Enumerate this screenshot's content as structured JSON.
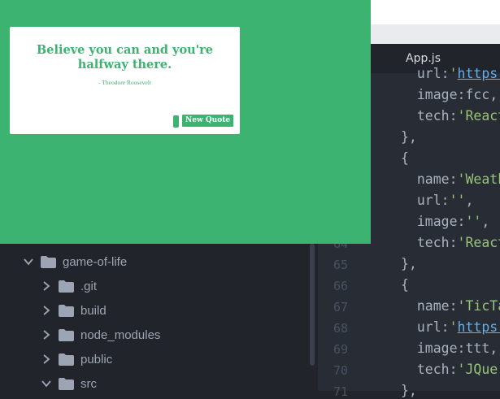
{
  "editor": {
    "tab_title": "App.js",
    "lines": [
      {
        "no": "",
        "tokens": [
          {
            "t": "  url:",
            "c": "k"
          },
          {
            "t": "'",
            "c": "s"
          },
          {
            "t": "https:",
            "c": "u"
          }
        ]
      },
      {
        "no": "",
        "tokens": [
          {
            "t": "  image:fcc,",
            "c": "k"
          }
        ]
      },
      {
        "no": "",
        "tokens": [
          {
            "t": "  tech:",
            "c": "k"
          },
          {
            "t": "'React",
            "c": "s"
          }
        ]
      },
      {
        "no": "",
        "tokens": [
          {
            "t": "},",
            "c": "p"
          }
        ]
      },
      {
        "no": "",
        "tokens": [
          {
            "t": "{",
            "c": "p"
          }
        ]
      },
      {
        "no": "",
        "tokens": [
          {
            "t": "  name:",
            "c": "k"
          },
          {
            "t": "'Weath",
            "c": "s"
          }
        ]
      },
      {
        "no": "",
        "tokens": [
          {
            "t": "  url:",
            "c": "k"
          },
          {
            "t": "''",
            "c": "s"
          },
          {
            "t": ",",
            "c": "p"
          }
        ]
      },
      {
        "no": "",
        "tokens": [
          {
            "t": "  image:",
            "c": "k"
          },
          {
            "t": "''",
            "c": "s"
          },
          {
            "t": ",",
            "c": "p"
          }
        ]
      },
      {
        "no": "64",
        "tokens": [
          {
            "t": "  tech:",
            "c": "k"
          },
          {
            "t": "'React",
            "c": "s"
          }
        ]
      },
      {
        "no": "65",
        "tokens": [
          {
            "t": "},",
            "c": "p"
          }
        ]
      },
      {
        "no": "66",
        "tokens": [
          {
            "t": "{",
            "c": "p"
          }
        ]
      },
      {
        "no": "67",
        "tokens": [
          {
            "t": "  name:",
            "c": "k"
          },
          {
            "t": "'TicTa",
            "c": "s"
          }
        ]
      },
      {
        "no": "68",
        "tokens": [
          {
            "t": "  url:",
            "c": "k"
          },
          {
            "t": "'",
            "c": "s"
          },
          {
            "t": "https:",
            "c": "u"
          }
        ]
      },
      {
        "no": "69",
        "tokens": [
          {
            "t": "  image:ttt,",
            "c": "k"
          }
        ]
      },
      {
        "no": "70",
        "tokens": [
          {
            "t": "  tech:",
            "c": "k"
          },
          {
            "t": "'JQuer",
            "c": "s"
          }
        ]
      },
      {
        "no": "71",
        "tokens": [
          {
            "t": "},",
            "c": "p"
          }
        ]
      }
    ]
  },
  "tree": {
    "items": [
      {
        "label": "game-of-life",
        "indent": 0,
        "expanded": true
      },
      {
        "label": ".git",
        "indent": 1,
        "expanded": false
      },
      {
        "label": "build",
        "indent": 1,
        "expanded": false
      },
      {
        "label": "node_modules",
        "indent": 1,
        "expanded": false
      },
      {
        "label": "public",
        "indent": 1,
        "expanded": false
      },
      {
        "label": "src",
        "indent": 1,
        "expanded": true
      }
    ]
  },
  "quote_app": {
    "quote": "Believe you can and you're halfway there.",
    "author": "- Theodore Roosevelt",
    "new_quote_label": "New Quote"
  },
  "colors": {
    "accent_green": "#3cb371",
    "editor_bg": "#282c34",
    "sidebar_bg": "#21252b"
  }
}
